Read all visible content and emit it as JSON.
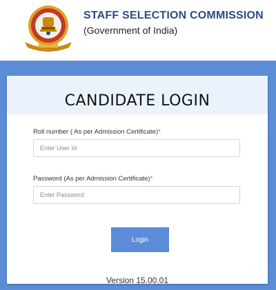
{
  "header": {
    "org_name": "STAFF SELECTION COMMISSION",
    "org_sub": "(Government of India)",
    "emblem_icon": "ssc-emblem-logo"
  },
  "colors": {
    "band": "#5b8cd7",
    "title_band": "#eaf3fb",
    "required_marker": "#e0421f"
  },
  "login": {
    "title": "CANDIDATE LOGIN",
    "roll_label": "Roll number ( As per Admission Certificate)",
    "roll_required": "*",
    "roll_value": "",
    "roll_placeholder": "Enter User Id",
    "password_label": "Password (As per Admission Certificate)",
    "password_required": "*",
    "password_value": "",
    "password_placeholder": "Enter Password",
    "button_label": "Login",
    "version": "Version 15.00.01"
  }
}
